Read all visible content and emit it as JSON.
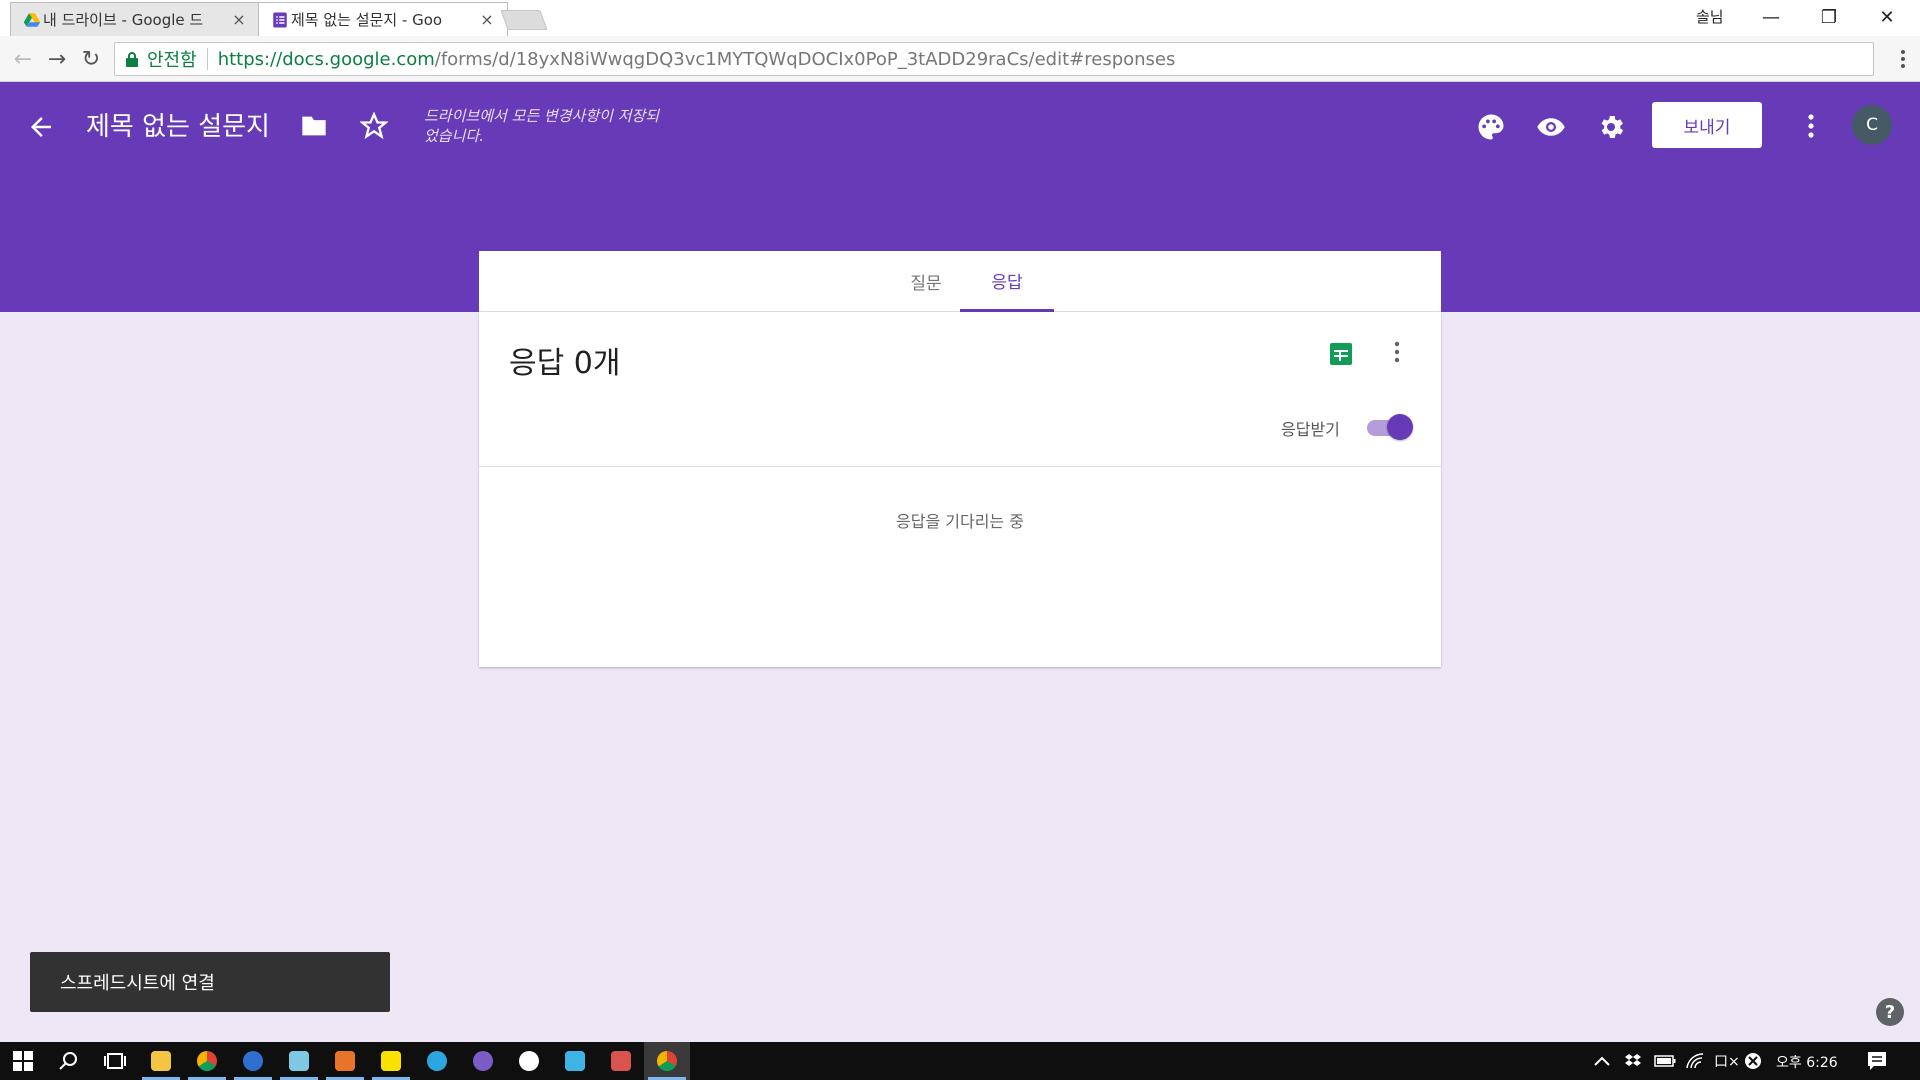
{
  "browser": {
    "tabs": [
      {
        "title": "내 드라이브 - Google 드",
        "close": "×"
      },
      {
        "title": "제목 없는 설문지 - Goo",
        "close": "×"
      }
    ],
    "user_name": "솔님",
    "window_controls": {
      "minimize": "—",
      "restore": "❐",
      "close": "✕"
    },
    "secure_label": "안전함",
    "url_domain": "https://docs.google.com",
    "url_path": "/forms/d/18yxN8iWwqgDQ3vc1MYTQWqDOCIx0PoP_3tADD29raCs/edit#responses"
  },
  "header": {
    "title": "제목 없는 설문지",
    "save_status": "드라이브에서 모든 변경사항이 저장되었습니다.",
    "send_label": "보내기",
    "avatar_letter": "C"
  },
  "form_tabs": {
    "questions": "질문",
    "responses": "응답"
  },
  "responses": {
    "count_label": "응답 0개",
    "accepting_label": "응답받기",
    "accepting": true,
    "waiting_text": "응답을 기다리는 중"
  },
  "snackbar": {
    "text": "스프레드시트에 연결"
  },
  "help": {
    "label": "?"
  },
  "taskbar": {
    "apps": [
      "start-icon",
      "search-icon",
      "task-view-icon",
      "file-explorer-icon",
      "chrome-icon",
      "app-blue-icon",
      "notepad-icon",
      "visual-studio-icon",
      "kakaotalk-icon",
      "telegram-icon",
      "app-purple-icon",
      "app-white-icon",
      "app-kakao-icon",
      "app-red-icon",
      "chrome-active-icon"
    ],
    "clock": "오후 6:26",
    "volume_label": "口×"
  },
  "colors": {
    "primary": "#673ab7",
    "background": "#ede7f6",
    "sheets_green": "#0f9d58"
  }
}
